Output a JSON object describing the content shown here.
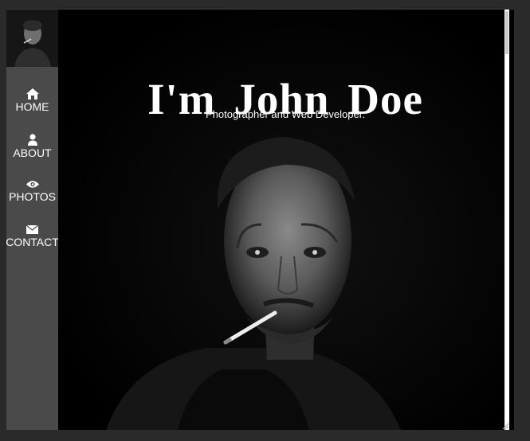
{
  "hero": {
    "title": "I'm John Doe",
    "subtitle": "Photographer and Web Developer."
  },
  "sidebar": {
    "avatar_alt": "Portrait of John Doe",
    "items": [
      {
        "label": "HOME",
        "icon": "home-icon"
      },
      {
        "label": "ABOUT",
        "icon": "user-icon"
      },
      {
        "label": "PHOTOS",
        "icon": "eye-icon"
      },
      {
        "label": "CONTACT",
        "icon": "envelope-icon"
      }
    ]
  },
  "colors": {
    "sidebar_bg": "#4a4a4a",
    "page_bg": "#000000",
    "text": "#ffffff"
  }
}
